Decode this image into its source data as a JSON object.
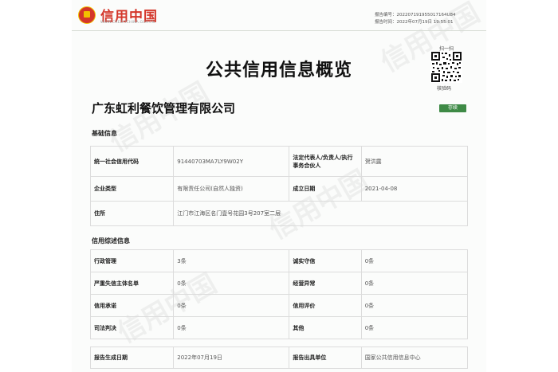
{
  "header": {
    "logo_text": "信用中国",
    "logo_url": "WWW.CREDITCHINA.GOV.CN",
    "report_no_label": "报告编号：",
    "report_no": "202207191955017164U84",
    "report_time_label": "报告时间：",
    "report_time": "2022年07月19日 19:55:01"
  },
  "title": "公共信用信息概览",
  "qr": {
    "scan_label": "扫一扫",
    "verify_label": "核验码"
  },
  "company": {
    "name": "广东虹利餐饮管理有限公司",
    "status": "存续"
  },
  "basic": {
    "title": "基础信息",
    "rows": [
      {
        "l1": "统一社会信用代码",
        "v1": "91440703MA7LY9W02Y",
        "l2": "法定代表人/负责人/执行事务合伙人",
        "v2": "贺洪露"
      },
      {
        "l1": "企业类型",
        "v1": "有限责任公司(自然人独资)",
        "l2": "成立日期",
        "v2": "2021-04-08"
      }
    ],
    "address_label": "住所",
    "address": "江门市江海区名门壹号花园3号207室二层"
  },
  "credit": {
    "title": "信用综述信息",
    "rows": [
      {
        "l1": "行政管理",
        "v1": "3条",
        "l2": "诚实守信",
        "v2": "0条"
      },
      {
        "l1": "严重失信主体名单",
        "v1": "0条",
        "l2": "经营异常",
        "v2": "0条"
      },
      {
        "l1": "信用承诺",
        "v1": "0条",
        "l2": "信用评价",
        "v2": "0条"
      },
      {
        "l1": "司法判决",
        "v1": "0条",
        "l2": "其他",
        "v2": "0条"
      }
    ]
  },
  "footer": {
    "l1": "报告生成日期",
    "v1": "2022年07月19日",
    "l2": "报告出具单位",
    "v2": "国家公共信用信息中心"
  },
  "colors": {
    "brand_red": "#d4362a",
    "status_green": "#3e8a46"
  }
}
